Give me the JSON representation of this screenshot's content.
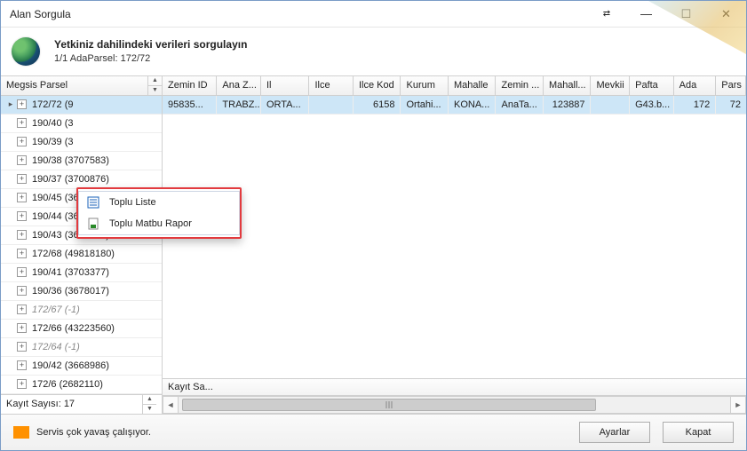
{
  "title": "Alan Sorgula",
  "header": {
    "title": "Yetkiniz dahilindeki verileri sorgulayın",
    "subtitle": "1/1 AdaParsel: 172/72"
  },
  "left_column_header": "Megsis Parsel",
  "columns": [
    "Zemin ID",
    "Ana Z...",
    "Il",
    "Ilce",
    "Ilce Kod",
    "Kurum",
    "Mahalle",
    "Zemin ...",
    "Mahall...",
    "Mevkii",
    "Pafta",
    "Ada",
    "Pars"
  ],
  "rows": [
    {
      "label": "172/72 (9",
      "selected": true,
      "marker": true,
      "italic": false
    },
    {
      "label": "190/40 (3",
      "italic": false
    },
    {
      "label": "190/39 (3",
      "italic": false
    },
    {
      "label": "190/38 (3707583)",
      "italic": false
    },
    {
      "label": "190/37 (3700876)",
      "italic": false
    },
    {
      "label": "190/45 (3668988)",
      "italic": false
    },
    {
      "label": "190/44 (3685597)",
      "italic": false
    },
    {
      "label": "190/43 (3668987)",
      "italic": false
    },
    {
      "label": "172/68 (49818180)",
      "italic": false
    },
    {
      "label": "190/41 (3703377)",
      "italic": false
    },
    {
      "label": "190/36 (3678017)",
      "italic": false
    },
    {
      "label": "172/67 (-1)",
      "italic": true
    },
    {
      "label": "172/66 (43223560)",
      "italic": false
    },
    {
      "label": "172/64 (-1)",
      "italic": true
    },
    {
      "label": "190/42 (3668986)",
      "italic": false
    },
    {
      "label": "172/6 (2682110)",
      "italic": false
    }
  ],
  "detail_row": {
    "zemin_id": "95835...",
    "ana_z": "TRABZ...",
    "il": "ORTA...",
    "ilce": "",
    "ilce_kod": "6158",
    "kurum": "Ortahi...",
    "mahalle": "KONA...",
    "zemin_t": "AnaTa...",
    "mahalle_id": "123887",
    "mevkii": "",
    "pafta": "G43.b...",
    "ada": "172",
    "pars": "72"
  },
  "context_menu": {
    "item1": "Toplu Liste",
    "item2": "Toplu Matbu Rapor"
  },
  "record_count_label": "Kayıt Sayısı:",
  "record_count_value": "17",
  "summary_label": "Kayıt Sa...",
  "status": "Servis çok yavaş çalışıyor.",
  "buttons": {
    "settings": "Ayarlar",
    "close": "Kapat"
  }
}
